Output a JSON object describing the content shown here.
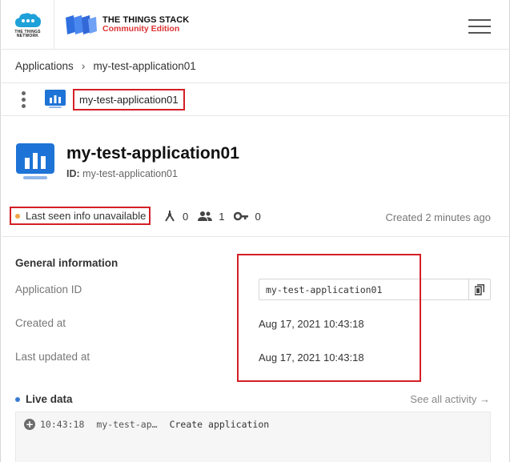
{
  "header": {
    "ttn_logo_text": "THE THINGS NETWORK",
    "brand_title": "THE THINGS STACK",
    "brand_subtitle": "Community Edition"
  },
  "breadcrumb": {
    "items": [
      "Applications",
      "my-test-application01"
    ]
  },
  "subbar": {
    "app_name": "my-test-application01"
  },
  "title": {
    "name": "my-test-application01",
    "id_label": "ID:",
    "id_value": "my-test-application01"
  },
  "status": {
    "last_seen": "Last seen info unavailable",
    "gateways_count": "0",
    "collaborators_count": "1",
    "api_keys_count": "0",
    "created_relative": "Created 2 minutes ago"
  },
  "general": {
    "title": "General information",
    "app_id_label": "Application ID",
    "app_id_value": "my-test-application01",
    "created_label": "Created at",
    "created_value": "Aug 17, 2021 10:43:18",
    "updated_label": "Last updated at",
    "updated_value": "Aug 17, 2021 10:43:18"
  },
  "live": {
    "title": "Live data",
    "see_all": "See all activity →",
    "events": [
      {
        "time": "10:43:18",
        "device": "my-test-ap…",
        "message": "Create application"
      }
    ]
  },
  "colors": {
    "highlight": "#d41f26",
    "accent_blue": "#1e73d6",
    "status_orange": "#f0a445"
  },
  "icons": [
    "ttn-cloud-logo-icon",
    "tts-stack-logo-icon",
    "hamburger-menu-icon",
    "chevron-right-icon",
    "kebab-menu-icon",
    "application-icon",
    "gateway-icon",
    "users-icon",
    "key-icon",
    "copy-icon",
    "plus-circle-icon"
  ]
}
